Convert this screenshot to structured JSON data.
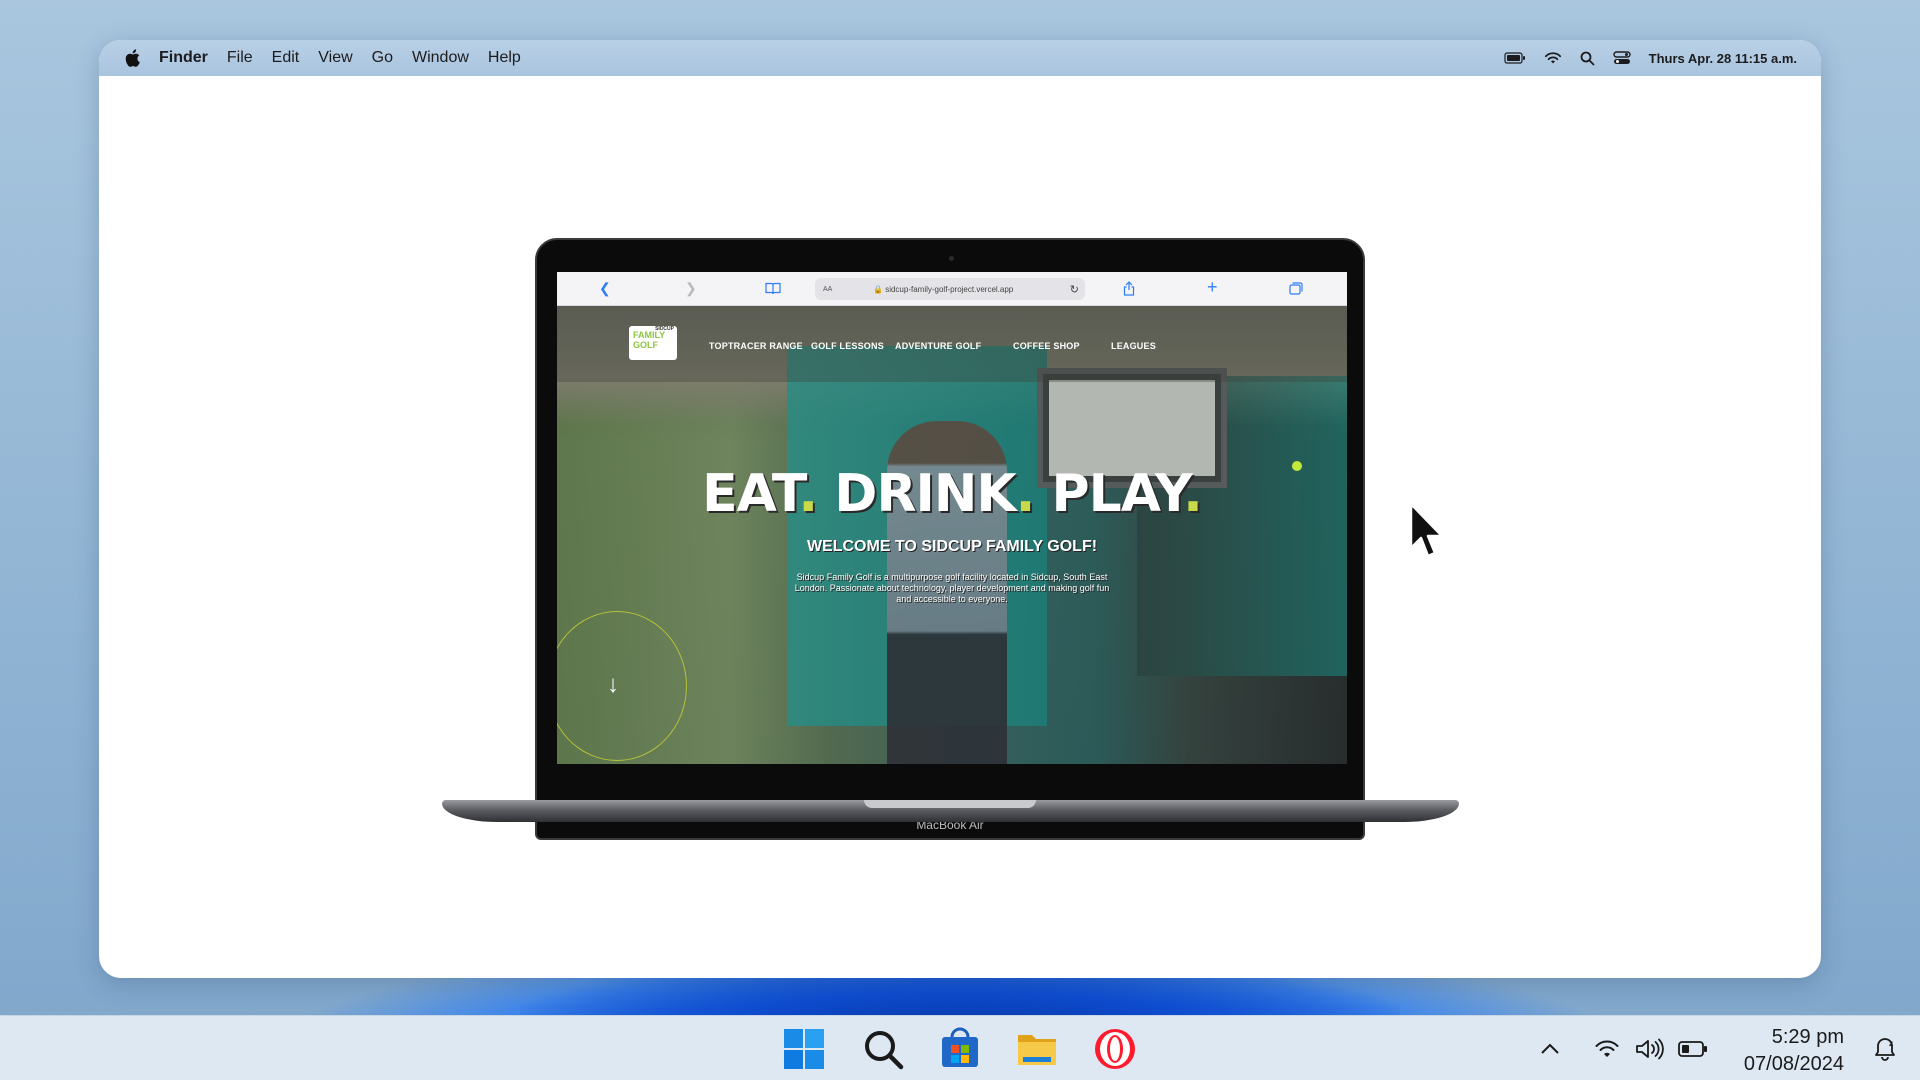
{
  "menubar": {
    "app_name": "Finder",
    "items": [
      "File",
      "Edit",
      "View",
      "Go",
      "Window",
      "Help"
    ],
    "datetime": "Thurs Apr. 28  11:15 a.m."
  },
  "laptop": {
    "label": "MacBook Air",
    "browser": {
      "url": "sidcup-family-golf-project.vercel.app",
      "aa": "AA"
    },
    "website": {
      "logo_small": "SIDCUP",
      "logo_line1": "FAMILY",
      "logo_line2": "GOLF",
      "nav": [
        "TOPTRACER RANGE",
        "GOLF LESSONS",
        "ADVENTURE GOLF",
        "COFFEE SHOP",
        "LEAGUES"
      ],
      "hero_title_1": "EAT",
      "hero_title_2": "DRINK",
      "hero_title_3": "PLAY",
      "hero_dot": ".",
      "hero_subtitle": "WELCOME TO SIDCUP FAMILY GOLF!",
      "hero_description": "Sidcup Family Golf is a multipurpose golf facility located in Sidcup, South East London. Passionate about technology, player development and making golf fun and accessible to everyone."
    }
  },
  "taskbar": {
    "apps": [
      "windows-start",
      "search",
      "microsoft-store",
      "file-explorer",
      "opera"
    ],
    "time": "5:29 pm",
    "date": "07/08/2024"
  }
}
